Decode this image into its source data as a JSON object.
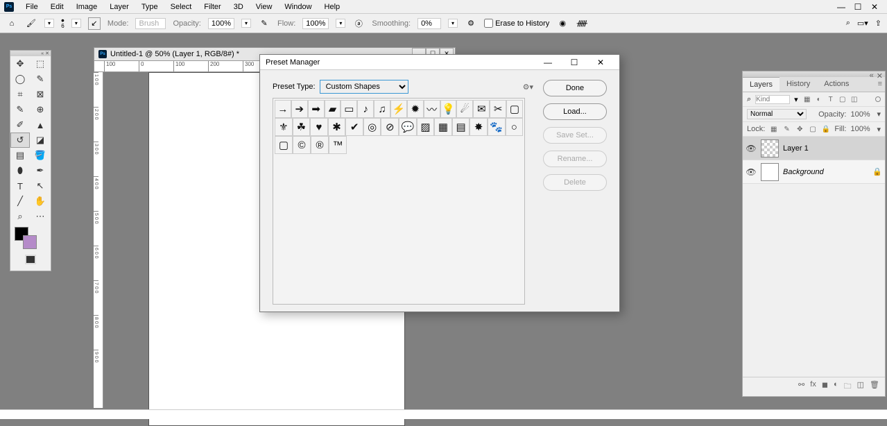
{
  "menu": {
    "items": [
      "File",
      "Edit",
      "Image",
      "Layer",
      "Type",
      "Select",
      "Filter",
      "3D",
      "View",
      "Window",
      "Help"
    ]
  },
  "window_controls": {
    "min": "—",
    "max": "☐",
    "close": "✕"
  },
  "options_bar": {
    "mode_label": "Mode:",
    "mode_value": "Brush",
    "opacity_label": "Opacity:",
    "opacity_value": "100%",
    "flow_label": "Flow:",
    "flow_value": "100%",
    "smoothing_label": "Smoothing:",
    "smoothing_value": "0%",
    "erase_history": "Erase to History",
    "size_num": "6"
  },
  "document": {
    "title": "Untitled-1 @ 50% (Layer 1, RGB/8#) *",
    "ruler_h": [
      "100",
      "0",
      "100",
      "200",
      "300"
    ],
    "ruler_v": [
      "1 0 0",
      "2 0 0",
      "3 0 0",
      "4 0 0",
      "5 0 0",
      "6 0 0",
      "7 0 0",
      "8 0 0",
      "9 0 0"
    ]
  },
  "layers_panel": {
    "tabs": [
      "Layers",
      "History",
      "Actions"
    ],
    "kind_label": "Kind",
    "blend_mode": "Normal",
    "opacity_label": "Opacity:",
    "opacity_value": "100%",
    "lock_label": "Lock:",
    "fill_label": "Fill:",
    "fill_value": "100%",
    "layers": [
      {
        "name": "Layer 1",
        "active": true,
        "trans": true,
        "locked": false
      },
      {
        "name": "Background",
        "active": false,
        "trans": false,
        "locked": true,
        "italic": true
      }
    ]
  },
  "dialog": {
    "title": "Preset Manager",
    "preset_type_label": "Preset Type:",
    "preset_type_value": "Custom Shapes",
    "buttons": {
      "done": "Done",
      "load": "Load...",
      "save": "Save Set...",
      "rename": "Rename...",
      "delete": "Delete"
    },
    "shapes_row1": [
      "→",
      "➔",
      "➡",
      "▰",
      "▭",
      "♪",
      "♫",
      "⚡",
      "✹",
      "〰",
      "💡",
      "☄",
      "✉",
      "✂",
      "▢"
    ],
    "shapes_row2": [
      "⚜",
      "☘",
      "♥",
      "✱",
      "✔",
      "◎",
      "⊘",
      "💬",
      "▨",
      "▦",
      "▤",
      "✸",
      "🐾",
      "○"
    ],
    "shapes_row3": [
      "▢",
      "©",
      "®",
      "™"
    ]
  }
}
